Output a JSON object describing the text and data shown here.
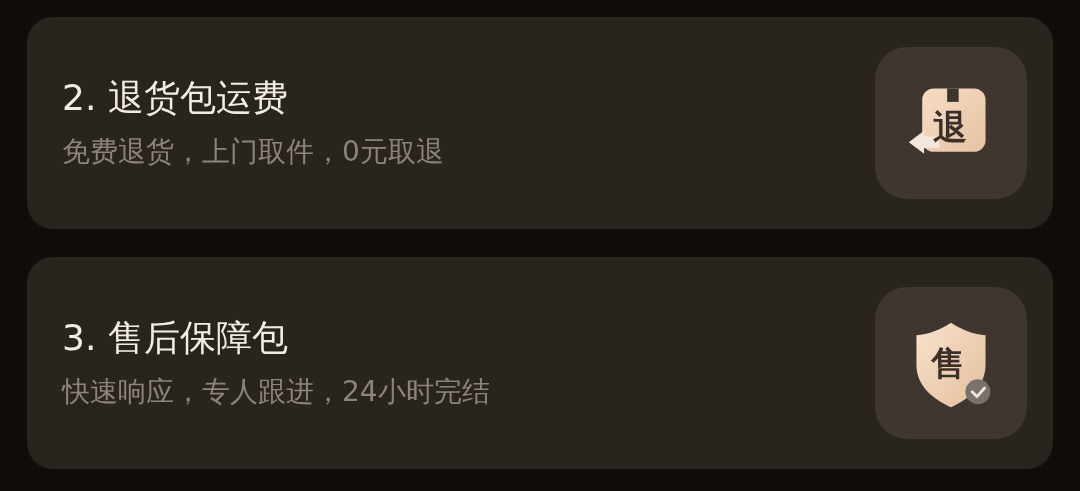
{
  "items": [
    {
      "title": "2. 退货包运费",
      "subtitle": "免费退货，上门取件，0元取退",
      "icon": {
        "kind": "box",
        "glyph": "退"
      }
    },
    {
      "title": "3. 售后保障包",
      "subtitle": "快速响应，专人跟进，24小时完结",
      "icon": {
        "kind": "shield",
        "glyph": "售"
      }
    }
  ]
}
